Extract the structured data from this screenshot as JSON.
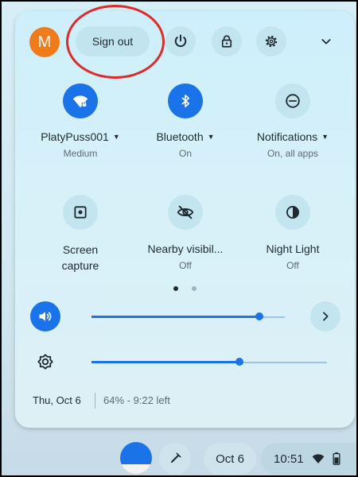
{
  "header": {
    "avatar_letter": "M",
    "sign_out_label": "Sign out",
    "icons": [
      "power-icon",
      "lock-icon",
      "gear-icon",
      "chevron-down-icon"
    ]
  },
  "tiles": [
    {
      "label": "PlatyPuss001",
      "sub": "Medium",
      "icon": "wifi-lock-icon",
      "active": true,
      "has_caret": true
    },
    {
      "label": "Bluetooth",
      "sub": "On",
      "icon": "bluetooth-icon",
      "active": true,
      "has_caret": true
    },
    {
      "label": "Notifications",
      "sub": "On, all apps",
      "icon": "do-not-disturb-icon",
      "active": false,
      "has_caret": true
    },
    {
      "label": "Screen capture",
      "sub": "",
      "icon": "screen-capture-icon",
      "active": false,
      "has_caret": false
    },
    {
      "label": "Nearby visibil...",
      "sub": "Off",
      "icon": "nearby-share-off-icon",
      "active": false,
      "has_caret": false
    },
    {
      "label": "Night Light",
      "sub": "Off",
      "icon": "night-light-icon",
      "active": false,
      "has_caret": false
    }
  ],
  "pagination": {
    "pages": 2,
    "current": 1
  },
  "sliders": {
    "volume": {
      "level": 0.87,
      "icon": "volume-icon"
    },
    "brightness": {
      "level": 0.63,
      "icon": "brightness-icon"
    }
  },
  "status": {
    "date": "Thu, Oct 6",
    "battery": "64% - 9:22 left"
  },
  "shelf": {
    "date": "Oct 6",
    "time": "10:51",
    "icons": [
      "stylus-icon",
      "wifi-icon",
      "battery-icon"
    ]
  },
  "colors": {
    "accent": "#1a73e8",
    "annotation": "#e02a2a",
    "avatar": "#f07b1a"
  }
}
